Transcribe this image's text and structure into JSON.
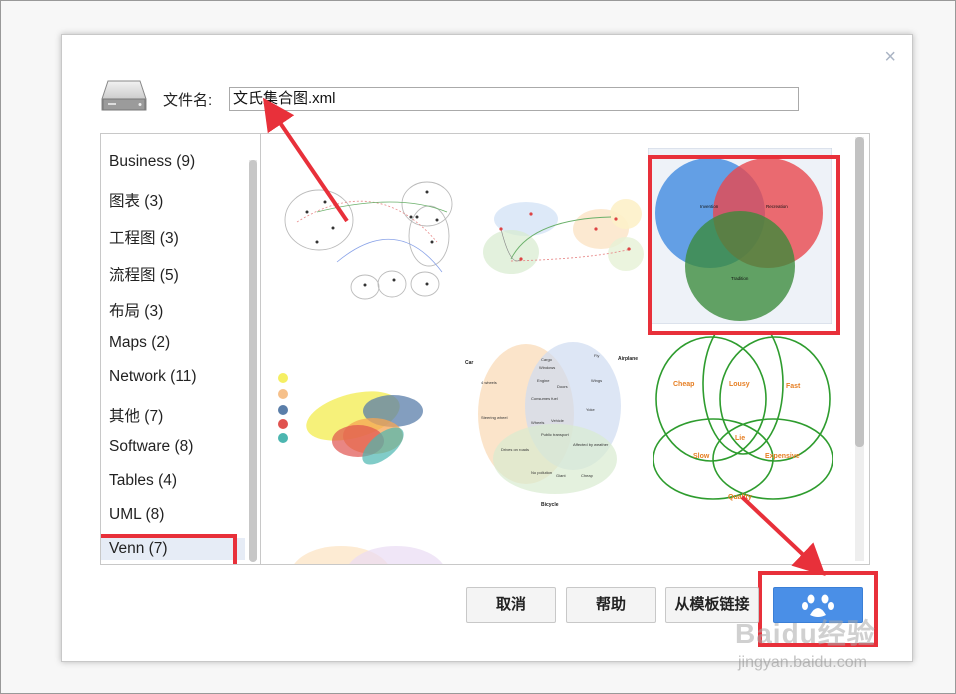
{
  "dialog": {
    "filename_label": "文件名:",
    "filename_value": "文氏集合图.xml",
    "close_glyph": "×"
  },
  "categories": [
    {
      "label": "Business (9)"
    },
    {
      "label": "图表 (3)"
    },
    {
      "label": "工程图 (3)"
    },
    {
      "label": "流程图 (5)"
    },
    {
      "label": "布局 (3)"
    },
    {
      "label": "Maps (2)"
    },
    {
      "label": "Network (11)"
    },
    {
      "label": "其他 (7)"
    },
    {
      "label": "Software (8)"
    },
    {
      "label": "Tables (4)"
    },
    {
      "label": "UML (8)"
    },
    {
      "label": "Venn (7)"
    }
  ],
  "selected_category": "Venn (7)",
  "thumb_labels": {
    "venn3": {
      "a": "Invention",
      "b": "Recreation",
      "c": "Tradition"
    },
    "venn4": {
      "car": "Car",
      "airplane": "Airplane",
      "bicycle": "Bicycle",
      "cargo": "Cargo",
      "windows": "Windows",
      "engine": "Engine",
      "doors": "Doors",
      "fly": "Fly",
      "wings": "Wings",
      "wheels": "4 wheels",
      "consumes_fuel": "Consumes fuel",
      "yoke": "Yoke",
      "steering": "Steering wheel",
      "wheels2": "Wheels",
      "vehicle": "Vehicle",
      "public_transport": "Public transport",
      "drives": "Drives on roads",
      "affected": "Affected by weather",
      "no_pollution": "No pollution",
      "giant": "Giant",
      "cheap": "Cheap"
    },
    "venn5": {
      "cheap": "Cheap",
      "lousy": "Lousy",
      "fast": "Fast",
      "lie": "Lie",
      "slow": "Slow",
      "expensive": "Expensive",
      "quality": "Quality"
    }
  },
  "buttons": {
    "cancel": "取消",
    "help": "帮助",
    "link": "从模板链接"
  },
  "watermark": {
    "brand": "Baidu经验",
    "url": "jingyan.baidu.com"
  },
  "colors": {
    "primary_button": "#4a8fe7",
    "highlight_red": "#e8303a",
    "venn_blue": "#4a90e2",
    "venn_red": "#e8474e",
    "venn_green": "#3a8a3a"
  }
}
